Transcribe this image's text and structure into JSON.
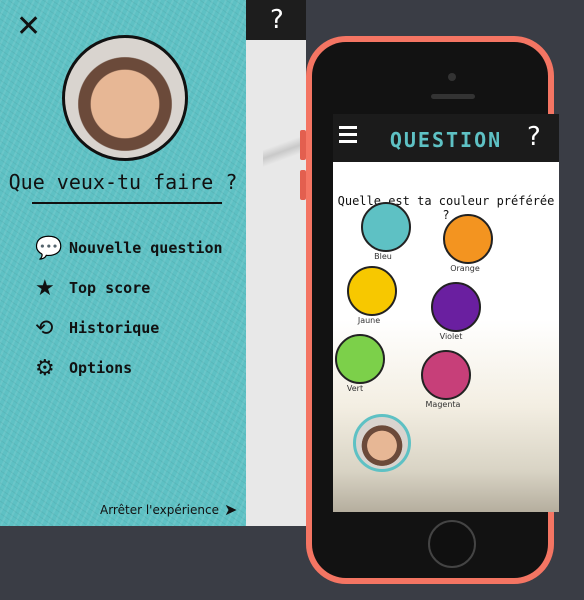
{
  "drawer": {
    "title": "Que veux-tu faire ?",
    "menu": [
      {
        "label": "Nouvelle question",
        "icon": "speech-bubble-icon"
      },
      {
        "label": "Top score",
        "icon": "star-icon"
      },
      {
        "label": "Historique",
        "icon": "history-icon"
      },
      {
        "label": "Options",
        "icon": "gears-icon"
      }
    ],
    "stop_label": "Arrêter l'expérience",
    "accent_color": "#5ec1c4"
  },
  "phone": {
    "color": "#f47563",
    "app": {
      "title": "QUESTION",
      "help": "?",
      "question": "Quelle est ta couleur préférée ?",
      "options": [
        {
          "label": "Bleu",
          "color": "#5ec1c4"
        },
        {
          "label": "Orange",
          "color": "#f39420"
        },
        {
          "label": "Jaune",
          "color": "#f7c800"
        },
        {
          "label": "Violet",
          "color": "#6a1fa0"
        },
        {
          "label": "Vert",
          "color": "#7cd04a"
        },
        {
          "label": "Magenta",
          "color": "#c73f79"
        }
      ]
    }
  },
  "backstrip": {
    "help": "?"
  }
}
